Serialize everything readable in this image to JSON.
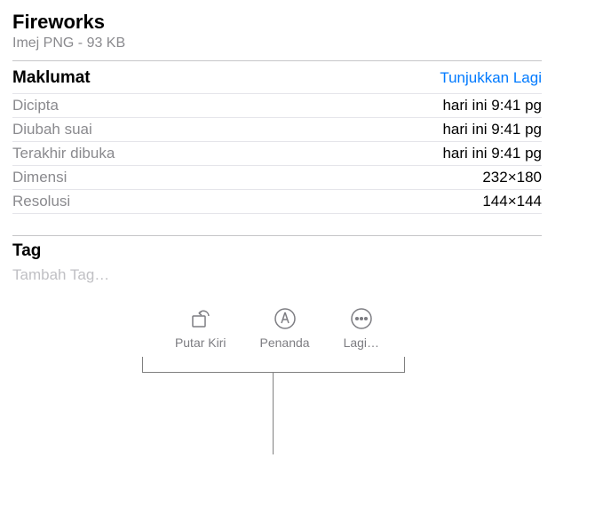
{
  "header": {
    "title": "Fireworks",
    "subtitle": "Imej PNG - 93 KB"
  },
  "info": {
    "section_label": "Maklumat",
    "show_more": "Tunjukkan Lagi",
    "rows": [
      {
        "label": "Dicipta",
        "value": "hari ini 9:41 pg"
      },
      {
        "label": "Diubah suai",
        "value": "hari ini 9:41 pg"
      },
      {
        "label": "Terakhir dibuka",
        "value": "hari ini 9:41 pg"
      },
      {
        "label": "Dimensi",
        "value": "232×180"
      },
      {
        "label": "Resolusi",
        "value": "144×144"
      }
    ]
  },
  "tags": {
    "section_label": "Tag",
    "placeholder": "Tambah Tag…"
  },
  "toolbar": {
    "rotate_label": "Putar Kiri",
    "markup_label": "Penanda",
    "more_label": "Lagi…"
  }
}
